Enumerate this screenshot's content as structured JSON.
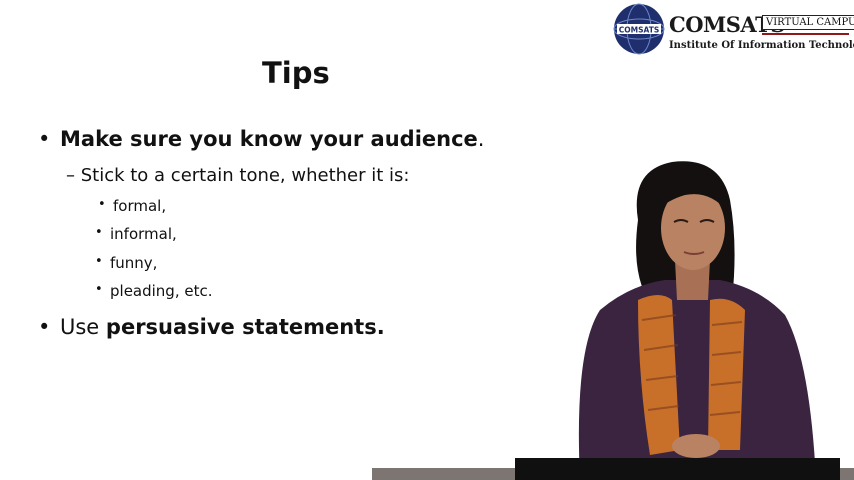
{
  "logo": {
    "globe_text": "COMSATS",
    "name": "COMSATS",
    "badge": "VIRTUAL CAMPUS",
    "subtitle": "Institute Of Information Technology"
  },
  "slide": {
    "title": "Tips",
    "bullets": [
      {
        "bold": "Make sure you know your audience",
        "rest": "."
      },
      {
        "plain": "Use ",
        "bold": "persuasive statements."
      }
    ],
    "sub_bullet": "– Stick to a certain tone, whether it is:",
    "tones": [
      "formal,",
      "informal,",
      "funny,",
      "pleading, etc."
    ]
  },
  "colors": {
    "logo_globe": "#1f2f6e",
    "logo_rule": "#8b1a1a",
    "sweater": "#3a2440",
    "scarf": "#c8702a",
    "hair": "#141010",
    "skin": "#b98263"
  },
  "icons": {
    "logo": "comsats-globe-logo"
  }
}
